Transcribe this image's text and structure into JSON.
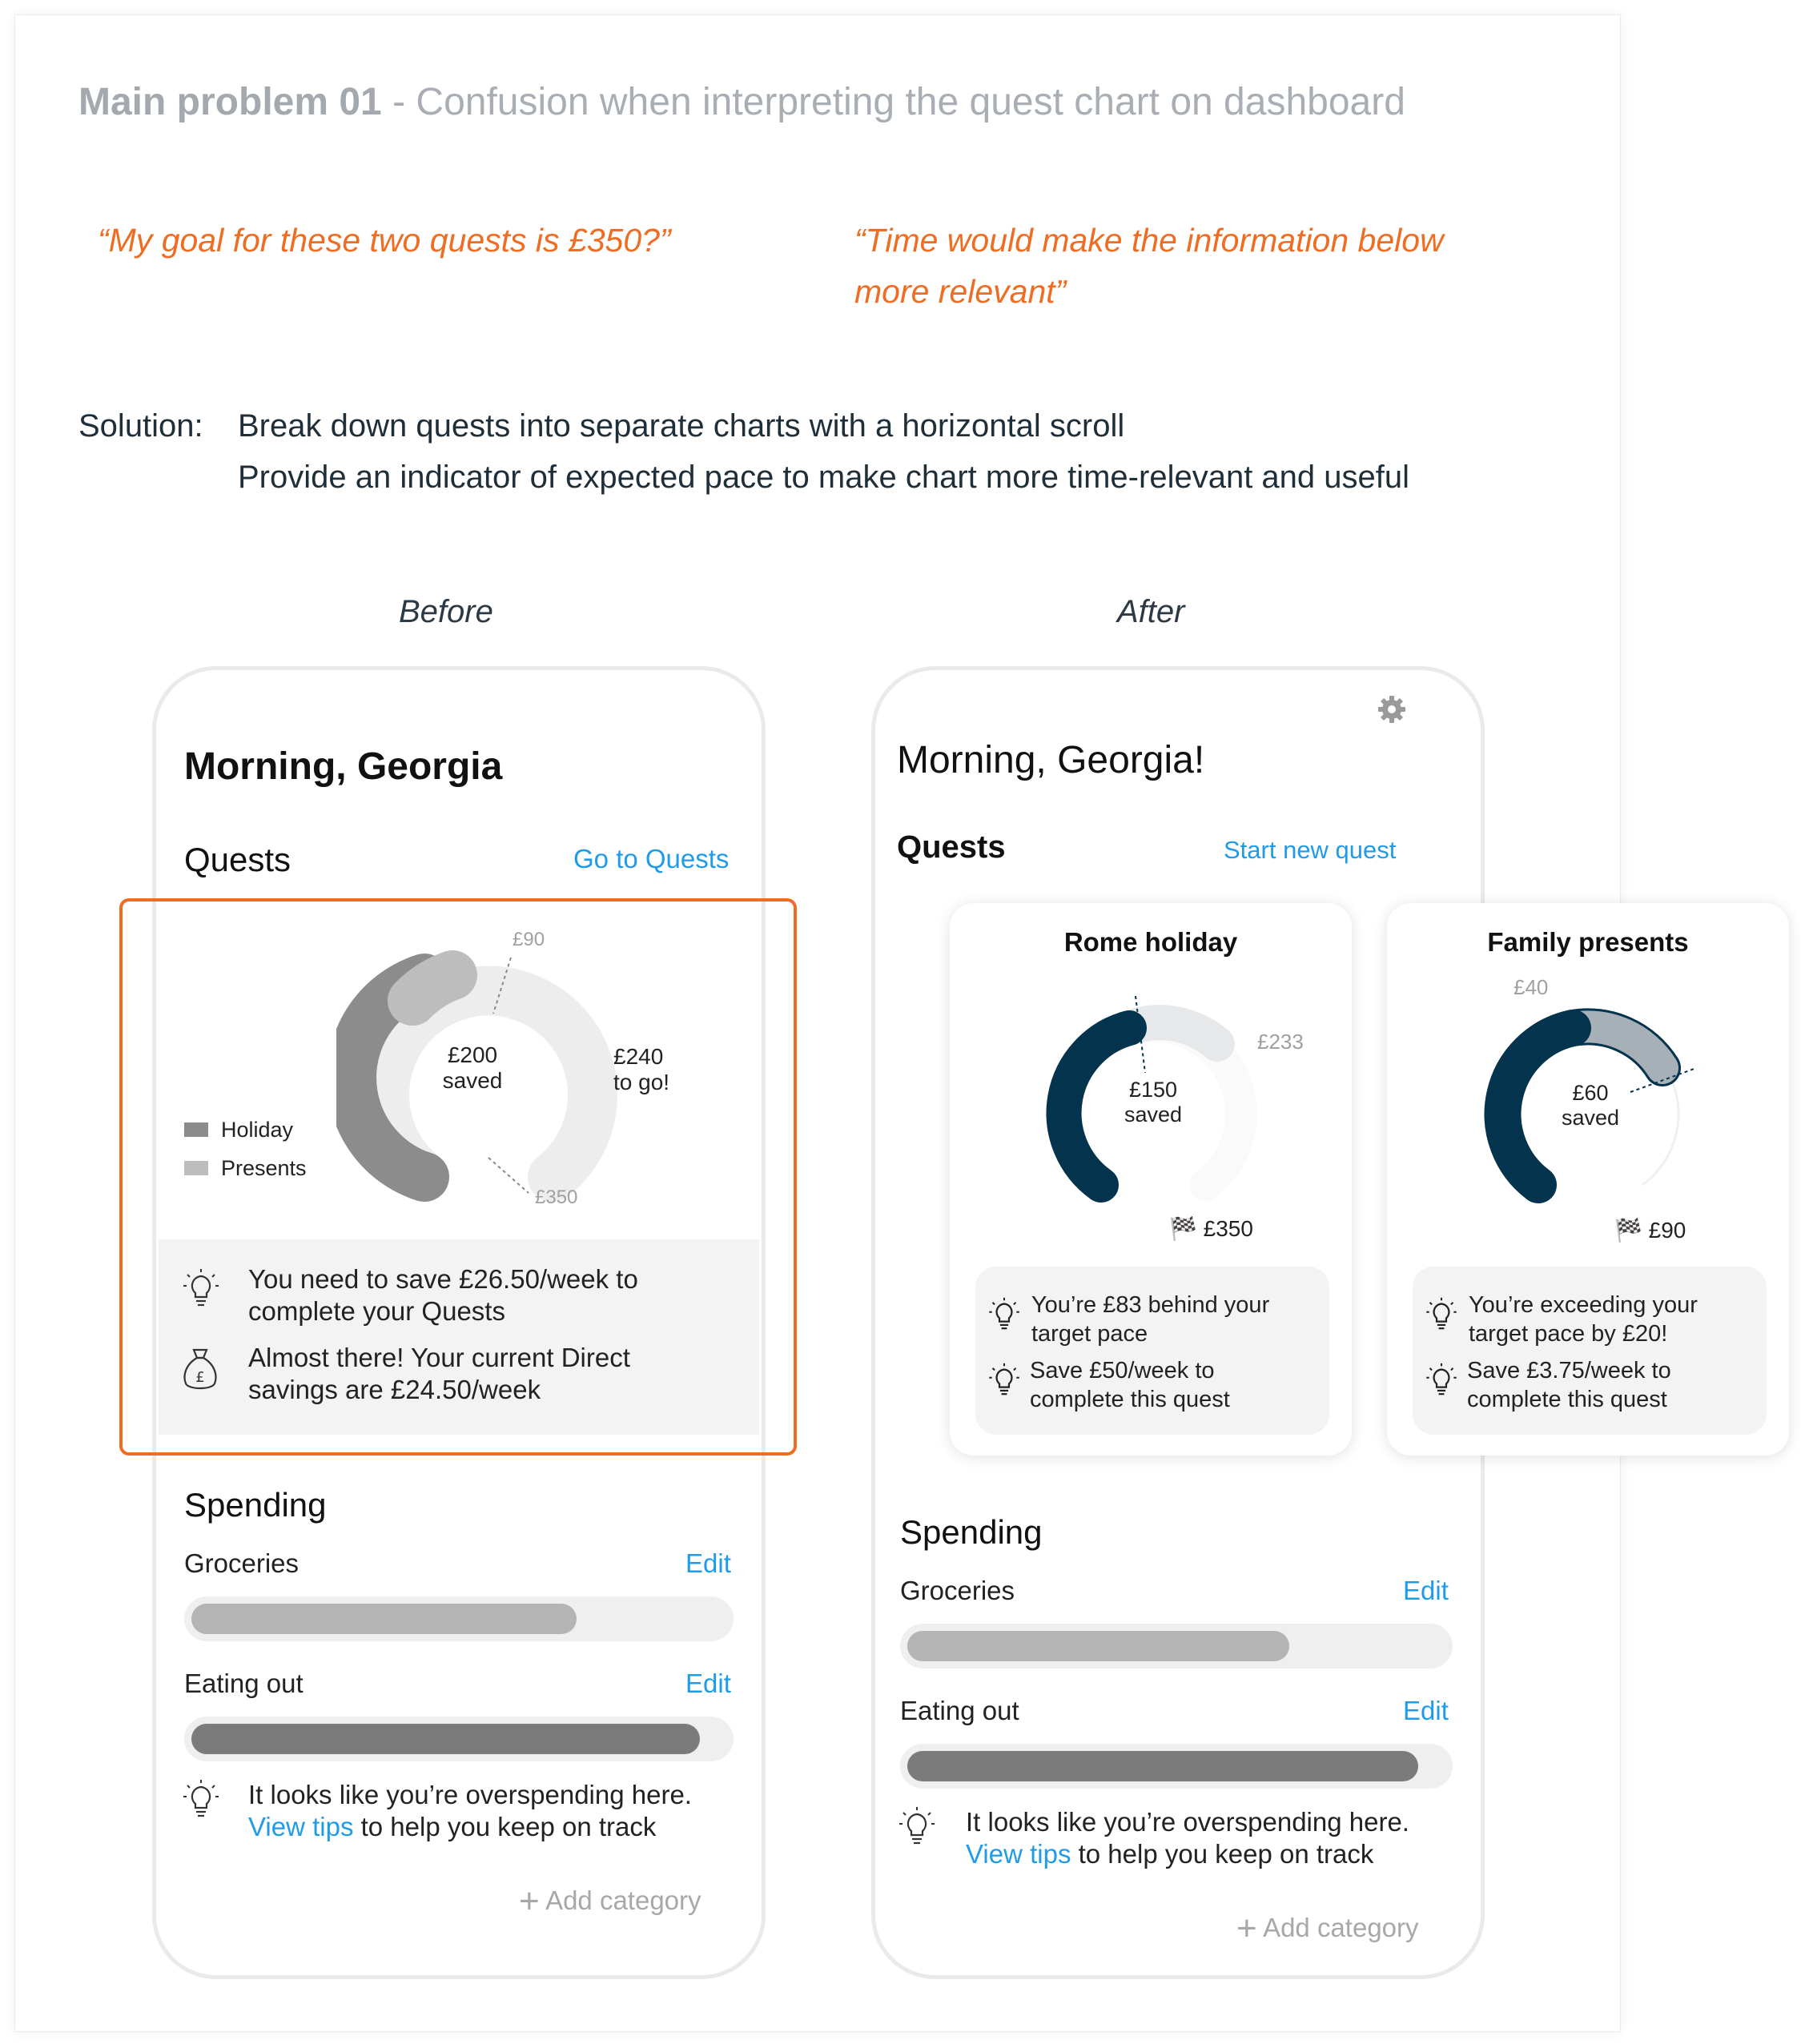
{
  "page": {
    "title_bold": "Main problem 01",
    "title_rest": "- Confusion when interpreting the quest chart on dashboard",
    "quote_left": "“My goal for these two quests is £350?”",
    "quote_right_line1": "“Time would make the information below",
    "quote_right_line2": "more relevant”",
    "solution_label": "Solution:",
    "solution_line1": "Break down quests into separate charts with a horizontal scroll",
    "solution_line2": "Provide an indicator of expected pace to make chart more time-relevant and useful",
    "before_label": "Before",
    "after_label": "After"
  },
  "colors": {
    "accent_orange": "#ef6d22",
    "link_blue": "#1e9be9",
    "navy": "#03334d",
    "gray_dark": "#8c8c8c",
    "gray_mid": "#b8b8b8",
    "gray_light": "#ededed"
  },
  "before": {
    "greeting": "Morning, Georgia",
    "quests_title": "Quests",
    "quests_link": "Go to Quests",
    "chart": {
      "top_label": "£90",
      "bottom_label": "£350",
      "center_amount": "£200",
      "center_sub": "saved",
      "togo_amount": "£240",
      "togo_sub": "to go!",
      "legend": [
        {
          "name": "Holiday",
          "color": "#8c8c8c"
        },
        {
          "name": "Presents",
          "color": "#bdbdbd"
        }
      ]
    },
    "tips": [
      {
        "icon": "lightbulb-icon",
        "line1": "You need to save £26.50/week to",
        "line2": "complete your Quests"
      },
      {
        "icon": "money-bag-icon",
        "line1": "Almost there! Your current Direct",
        "line2": "savings are £24.50/week"
      }
    ],
    "spending": {
      "title": "Spending",
      "rows": [
        {
          "name": "Groceries",
          "edit": "Edit",
          "fill": 0.72,
          "color": "#b4b4b4"
        },
        {
          "name": "Eating out",
          "edit": "Edit",
          "fill": 0.95,
          "color": "#7b7b7b"
        }
      ],
      "tip_line1": "It looks like you’re overspending here.",
      "tip_link": "View tips",
      "tip_rest": " to help you keep on track",
      "add_category": "Add category"
    }
  },
  "after": {
    "greeting": "Morning, Georgia!",
    "quests_title": "Quests",
    "quests_link": "Start new quest",
    "quests": [
      {
        "title": "Rome holiday",
        "pace_label": "£233",
        "center_amount": "£150",
        "center_sub": "saved",
        "goal": "£350",
        "tip1_line1": "You’re £83 behind your",
        "tip1_line2": "target pace",
        "tip2_line1": "Save £50/week to",
        "tip2_line2": "complete this quest"
      },
      {
        "title": "Family presents",
        "pace_label": "£40",
        "center_amount": "£60",
        "center_sub": "saved",
        "goal": "£90",
        "tip1_line1": "You’re exceeding your",
        "tip1_line2": "target pace by £20!",
        "tip2_line1": "Save £3.75/week to",
        "tip2_line2": "complete this quest"
      }
    ],
    "spending": {
      "title": "Spending",
      "rows": [
        {
          "name": "Groceries",
          "edit": "Edit",
          "fill": 0.71,
          "color": "#b4b4b4"
        },
        {
          "name": "Eating out",
          "edit": "Edit",
          "fill": 0.95,
          "color": "#7b7b7b"
        }
      ],
      "tip_line1": "It looks like you’re overspending here.",
      "tip_link": "View tips",
      "tip_rest": " to help you keep on track",
      "add_category": "Add category"
    }
  }
}
